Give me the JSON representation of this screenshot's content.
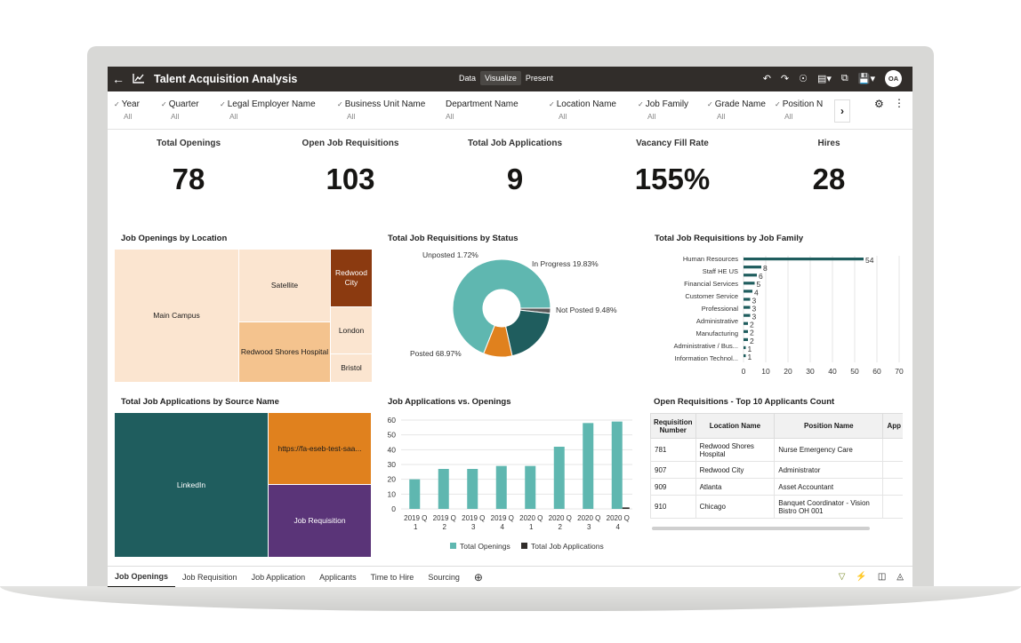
{
  "app": {
    "title": "Talent Acquisition Analysis",
    "user_initials": "OA"
  },
  "modes": [
    "Data",
    "Visualize",
    "Present"
  ],
  "active_mode": "Visualize",
  "toolbar_icons": [
    "back-arrow-icon",
    "analytics-icon",
    "undo-icon",
    "redo-icon",
    "refresh-icon",
    "comment-icon",
    "export-icon",
    "save-icon"
  ],
  "filters": [
    {
      "label": "Year",
      "value": "All"
    },
    {
      "label": "Quarter",
      "value": "All"
    },
    {
      "label": "Legal Employer Name",
      "value": "All"
    },
    {
      "label": "Business Unit Name",
      "value": "All"
    },
    {
      "label": "Department Name",
      "value": "All"
    },
    {
      "label": "Location Name",
      "value": "All"
    },
    {
      "label": "Job Family",
      "value": "All"
    },
    {
      "label": "Grade Name",
      "value": "All"
    },
    {
      "label": "Position N",
      "value": "All"
    }
  ],
  "kpis": [
    {
      "label": "Total Openings",
      "value": "78"
    },
    {
      "label": "Open Job Requisitions",
      "value": "103"
    },
    {
      "label": "Total Job Applications",
      "value": "9"
    },
    {
      "label": "Vacancy Fill Rate",
      "value": "155%"
    },
    {
      "label": "Hires",
      "value": "28"
    }
  ],
  "panels": {
    "openings_by_location": {
      "title": "Job Openings by Location",
      "cells": [
        "Main Campus",
        "Satellite",
        "Redwood City",
        "Redwood Shores Hospital",
        "London",
        "Bristol"
      ]
    },
    "req_by_status": {
      "title": "Total Job Requisitions by Status",
      "slices": [
        {
          "label": "Posted",
          "pct": 68.97,
          "text": "Posted 68.97%",
          "color": "#5fb7b0"
        },
        {
          "label": "Unposted",
          "pct": 1.72,
          "text": "Unposted 1.72%",
          "color": "#5a5a5a"
        },
        {
          "label": "In Progress",
          "pct": 19.83,
          "text": "In Progress 19.83%",
          "color": "#1f5d5e"
        },
        {
          "label": "Not Posted",
          "pct": 9.48,
          "text": "Not Posted 9.48%",
          "color": "#e0811e"
        }
      ]
    },
    "req_by_family": {
      "title": "Total Job Requisitions by Job Family",
      "labels": [
        "Human Resources",
        "Staff HE US",
        "Financial Services",
        "Customer Service",
        "Professional",
        "Administrative",
        "Manufacturing",
        "Administrative / Bus...",
        "Information Technol..."
      ],
      "values": [
        54,
        8,
        6,
        5,
        4,
        3,
        3,
        3,
        2,
        2,
        2,
        1,
        1
      ],
      "xticks": [
        "0",
        "10",
        "20",
        "30",
        "40",
        "50",
        "60",
        "70"
      ],
      "color": "#1f5d5e"
    },
    "apps_by_source": {
      "title": "Total Job Applications by Source Name",
      "cells": [
        "LinkedIn",
        "https://fa-eseb-test-saa...",
        "Job Requisition"
      ]
    },
    "apps_vs_openings": {
      "title": "Job Applications vs. Openings",
      "legend": [
        "Total Openings",
        "Total Job Applications"
      ],
      "categories": [
        "2019 Q 1",
        "2019 Q 2",
        "2019 Q 3",
        "2019 Q 4",
        "2020 Q 1",
        "2020 Q 2",
        "2020 Q 3",
        "2020 Q 4"
      ],
      "yticks": [
        "0",
        "10",
        "20",
        "30",
        "40",
        "50",
        "60"
      ]
    },
    "top_requisitions": {
      "title": "Open Requisitions - Top 10 Applicants Count",
      "headers": [
        "Requisition Number",
        "Location Name",
        "Position Name",
        "App Co"
      ],
      "rows": [
        [
          "781",
          "Redwood Shores Hospital",
          "Nurse Emergency Care",
          ""
        ],
        [
          "907",
          "Redwood City",
          "Administrator",
          ""
        ],
        [
          "909",
          "Atlanta",
          "Asset Accountant",
          ""
        ],
        [
          "910",
          "Chicago",
          "Banquet Coordinator - Vision Bistro OH 001",
          ""
        ]
      ]
    }
  },
  "tabs": [
    "Job Openings",
    "Job Requisition",
    "Job Application",
    "Applicants",
    "Time to Hire",
    "Sourcing"
  ],
  "active_tab": "Job Openings",
  "chart_data": [
    {
      "type": "pie",
      "title": "Total Job Requisitions by Status",
      "categories": [
        "Posted",
        "Unposted",
        "In Progress",
        "Not Posted"
      ],
      "values": [
        68.97,
        1.72,
        19.83,
        9.48
      ]
    },
    {
      "type": "bar",
      "title": "Total Job Requisitions by Job Family",
      "values": [
        54,
        8,
        6,
        5,
        4,
        3,
        3,
        3,
        2,
        2,
        2,
        1,
        1
      ],
      "xlim": [
        0,
        70
      ]
    },
    {
      "type": "bar",
      "title": "Job Applications vs. Openings",
      "categories": [
        "2019 Q 1",
        "2019 Q 2",
        "2019 Q 3",
        "2019 Q 4",
        "2020 Q 1",
        "2020 Q 2",
        "2020 Q 3",
        "2020 Q 4"
      ],
      "series": [
        {
          "name": "Total Openings",
          "values": [
            20,
            27,
            27,
            29,
            29,
            42,
            58,
            59
          ],
          "color": "#5fb7b0"
        },
        {
          "name": "Total Job Applications",
          "values": [
            0,
            0,
            0,
            0,
            0,
            0,
            0,
            1
          ],
          "color": "#312d2a"
        }
      ],
      "ylim": [
        0,
        60
      ]
    }
  ]
}
